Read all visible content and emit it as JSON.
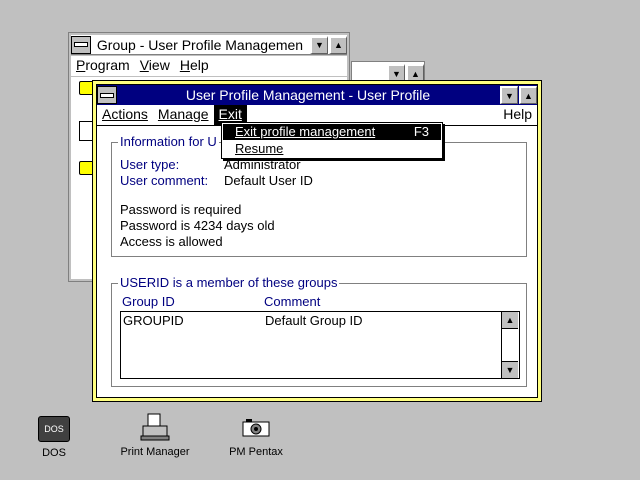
{
  "back_window": {
    "title": "Group - User Profile Managemen",
    "menu": [
      "Program",
      "View",
      "Help"
    ],
    "menu_mnemonics": [
      "P",
      "V",
      "H"
    ]
  },
  "main_window": {
    "title": "User Profile Management - User Profile",
    "menu": {
      "actions": "Actions",
      "manage": "Manage",
      "exit": "Exit",
      "help": "Help"
    },
    "exit_menu": {
      "item1_label": "Exit profile management",
      "item1_accel": "F3",
      "item2_label": "Resume"
    },
    "info_group": {
      "label": "Information for U",
      "user_type_label": "User type:",
      "user_type_value": "Administrator",
      "user_comment_label": "User comment:",
      "user_comment_value": "Default User ID",
      "line1": "Password is required",
      "line2": "Password is 4234 days old",
      "line3": "Access is allowed"
    },
    "groups_group": {
      "label": "USERID is a member of these groups",
      "col1": "Group ID",
      "col2": "Comment",
      "rows": [
        {
          "group_id": "GROUPID",
          "comment": "Default Group ID"
        }
      ]
    }
  },
  "desktop_icons": [
    {
      "label": "DOS",
      "badge": "DOS"
    },
    {
      "label": "Print Manager"
    },
    {
      "label": "PM Pentax"
    }
  ],
  "colors": {
    "desktop": "#c0c0c0",
    "active_title": "#000080",
    "frame_yellow": "#ffff80",
    "menu_highlight": "#000000"
  }
}
